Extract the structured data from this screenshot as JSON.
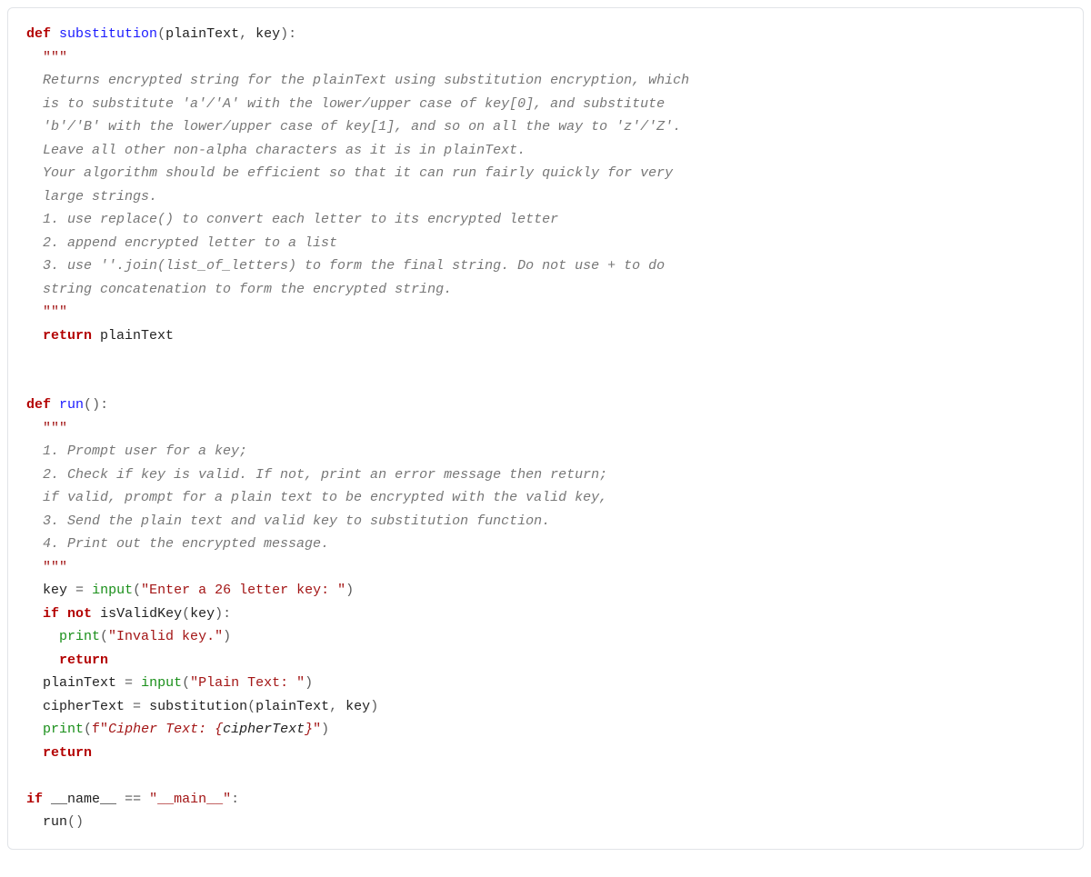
{
  "code": {
    "l1": {
      "kw_def": "def",
      "fn": "substitution",
      "lp": "(",
      "a1": "plainText",
      "c1": ",",
      "sp": " ",
      "a2": "key",
      "rp": ")",
      "col": ":"
    },
    "l2": {
      "tq": "\"\"\""
    },
    "doc1": [
      "  Returns encrypted string for the plainText using substitution encryption, which",
      "  is to substitute 'a'/'A' with the lower/upper case of key[0], and substitute",
      "  'b'/'B' with the lower/upper case of key[1], and so on all the way to 'z'/'Z'.",
      "  Leave all other non-alpha characters as it is in plainText.",
      "  Your algorithm should be efficient so that it can run fairly quickly for very",
      "  large strings.",
      "  1. use replace() to convert each letter to its encrypted letter",
      "  2. append encrypted letter to a list",
      "  3. use ''.join(list_of_letters) to form the final string. Do not use + to do",
      "  string concatenation to form the encrypted string."
    ],
    "l3": {
      "tq": "\"\"\""
    },
    "l4": {
      "kw_return": "return",
      "var": "plainText"
    },
    "l5": {
      "kw_def": "def",
      "fn": "run",
      "lp": "(",
      "rp": ")",
      "col": ":"
    },
    "l6": {
      "tq": "\"\"\""
    },
    "doc2": [
      "  1. Prompt user for a key;",
      "  2. Check if key is valid. If not, print an error message then return;",
      "  if valid, prompt for a plain text to be encrypted with the valid key,",
      "  3. Send the plain text and valid key to substitution function.",
      "  4. Print out the encrypted message."
    ],
    "l7": {
      "tq": "\"\"\""
    },
    "l8": {
      "v": "key",
      "eq": "=",
      "fn": "input",
      "lp": "(",
      "s": "\"Enter a 26 letter key: \"",
      "rp": ")"
    },
    "l9": {
      "kw_if": "if",
      "kw_not": "not",
      "fn": "isValidKey",
      "lp": "(",
      "a": "key",
      "rp": ")",
      "col": ":"
    },
    "l10": {
      "fn": "print",
      "lp": "(",
      "s": "\"Invalid key.\"",
      "rp": ")"
    },
    "l11": {
      "kw_return": "return"
    },
    "l12": {
      "v": "plainText",
      "eq": "=",
      "fn": "input",
      "lp": "(",
      "s": "\"Plain Text: \"",
      "rp": ")"
    },
    "l13": {
      "v": "cipherText",
      "eq": "=",
      "fn": "substitution",
      "lp": "(",
      "a1": "plainText",
      "c": ",",
      "a2": "key",
      "rp": ")"
    },
    "l14": {
      "fn": "print",
      "lp": "(",
      "pfx": "f\"",
      "body1": "Cipher Text: ",
      "lb": "{",
      "iv": "cipherText",
      "rb": "}",
      "sfx": "\"",
      "rp": ")"
    },
    "l15": {
      "kw_return": "return"
    },
    "l16": {
      "kw_if": "if",
      "v": "__name__",
      "eq": "==",
      "s": "\"__main__\"",
      "col": ":"
    },
    "l17": {
      "fn": "run",
      "lp": "(",
      "rp": ")"
    }
  }
}
